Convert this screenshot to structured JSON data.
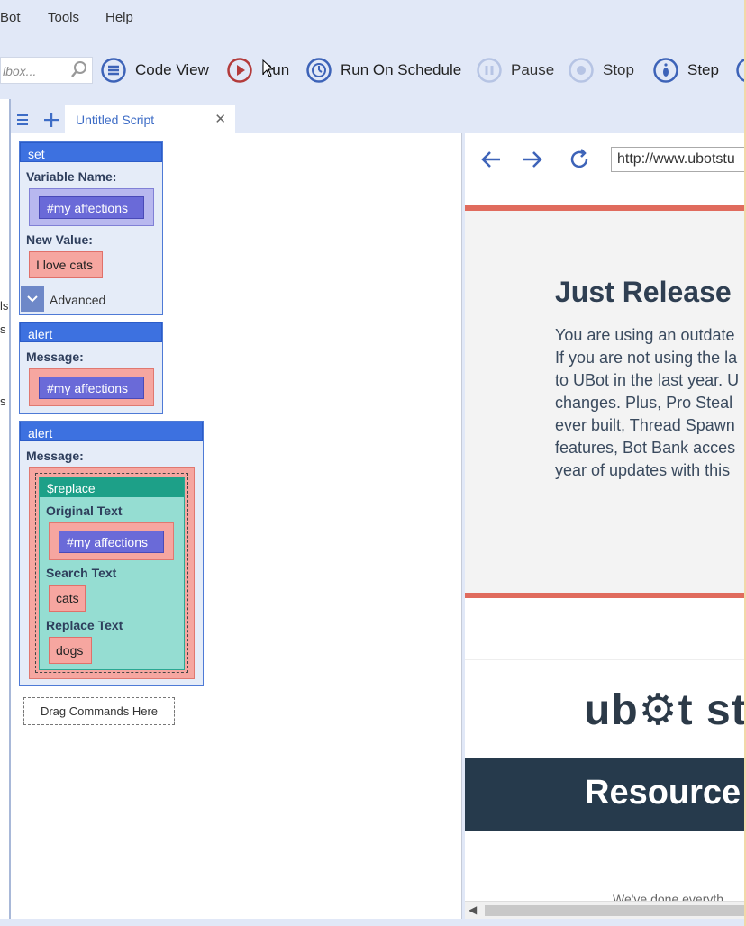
{
  "menu": [
    "Bot",
    "Tools",
    "Help"
  ],
  "search": {
    "placeholder": "lbox..."
  },
  "toolbar": {
    "code_view": "Code View",
    "run": "Run",
    "run_on_schedule": "Run On Schedule",
    "pause": "Pause",
    "stop": "Stop",
    "step": "Step"
  },
  "tabs": {
    "active_label": "Untitled Script"
  },
  "left_edge_fragments": [
    "ls",
    "s",
    "s"
  ],
  "script": {
    "set_command": {
      "title": "set",
      "variable_name_label": "Variable Name:",
      "variable_value": "#my affections",
      "new_value_label": "New Value:",
      "new_value": "I love cats",
      "advanced_label": "Advanced"
    },
    "alert1": {
      "title": "alert",
      "message_label": "Message:",
      "message_value": "#my affections"
    },
    "alert2": {
      "title": "alert",
      "message_label": "Message:",
      "replace": {
        "title": "$replace",
        "original_label": "Original Text",
        "original_value": "#my affections",
        "search_label": "Search Text",
        "search_value": "cats",
        "replace_label": "Replace Text",
        "replace_value": "dogs"
      }
    },
    "drag_hint": "Drag Commands Here"
  },
  "browser": {
    "url": "http://www.ubotstu",
    "headline": "Just Release",
    "paragraph_lines": [
      "You are using an outdate",
      "If you are not using the la",
      "to UBot in the last year. U",
      "changes. Plus, Pro Steal",
      "ever built, Thread Spawn",
      "features, Bot Bank acces",
      "year of updates with this"
    ],
    "logo_text": "ub⚙t st",
    "resources_text": "Resource",
    "footer_text": "We've done everyth"
  },
  "colors": {
    "chrome_bg": "#e1e8f7",
    "command_header": "#3d71e0",
    "variable": "#6a6ad8",
    "string": "#f6a6a0",
    "function_header": "#1da088",
    "accent_red": "#e06b5d"
  }
}
